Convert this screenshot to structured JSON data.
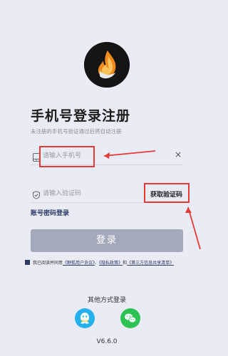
{
  "title": "手机号登录注册",
  "subtitle": "未注册的手机号验证通过后将自动注册",
  "phone_field": {
    "placeholder": "请输入手机号",
    "clear_symbol": "×"
  },
  "code_field": {
    "placeholder": "请输入验证码"
  },
  "get_code_label": "获取验证码",
  "password_login_label": "账号密码登录",
  "login_button_label": "登录",
  "agreement": {
    "prefix": "我已阅读并同意",
    "user_agreement": "《野狐用户协议》",
    "privacy_policy": "《隐私政策》",
    "and": "和",
    "third_party": "《第三方信息共享清单》"
  },
  "other_login_label": "其他方式登录",
  "social_icons": [
    "qq-icon",
    "wechat-icon"
  ],
  "version": "V6.6.0",
  "colors": {
    "background": "#e9ebf5",
    "login_button": "#a5aabb",
    "link": "#2c3a67",
    "annotation": "#e53a35",
    "qq": "#24b1ee",
    "wechat": "#2cc254"
  }
}
